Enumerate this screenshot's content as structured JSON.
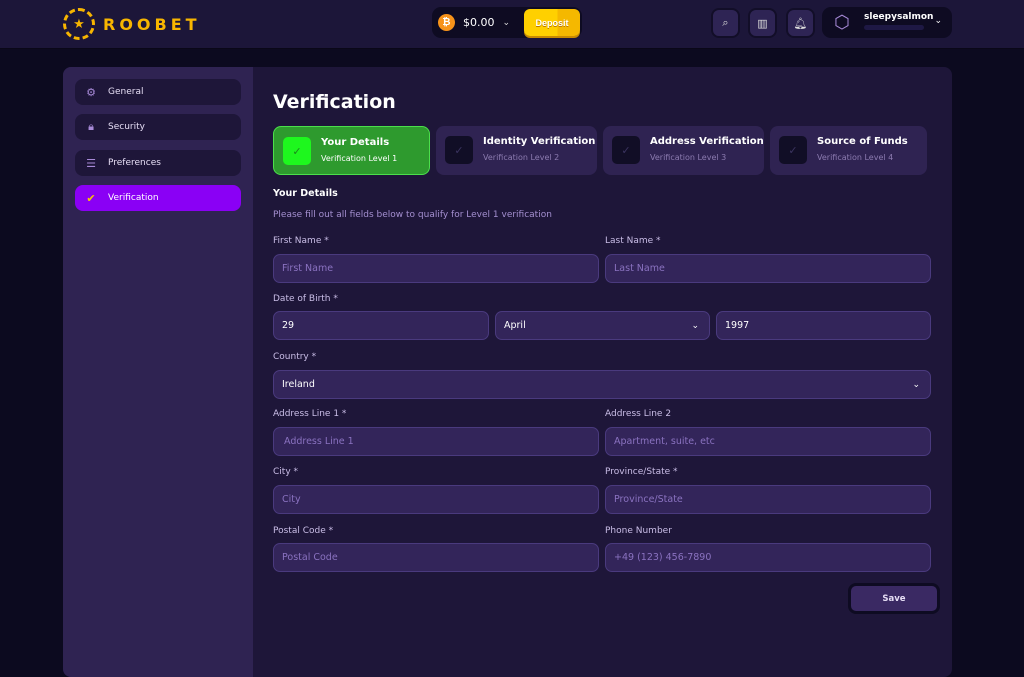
{
  "header": {
    "brand": "ROOBET",
    "balance": "$0.00",
    "deposit_label": "Deposit",
    "username": "sleepysalmon"
  },
  "sidebar": {
    "items": [
      {
        "label": "General",
        "icon": "gear-icon"
      },
      {
        "label": "Security",
        "icon": "lock-icon"
      },
      {
        "label": "Preferences",
        "icon": "sliders-icon"
      },
      {
        "label": "Verification",
        "icon": "check-circle-icon",
        "active": true
      }
    ]
  },
  "main": {
    "title": "Verification",
    "steps": [
      {
        "title": "Your Details",
        "subtitle": "Verification Level 1",
        "done": true
      },
      {
        "title": "Identity Verification",
        "subtitle": "Verification Level 2"
      },
      {
        "title": "Address Verification",
        "subtitle": "Verification Level 3"
      },
      {
        "title": "Source of Funds",
        "subtitle": "Verification Level 4"
      }
    ],
    "section_title": "Your Details",
    "section_desc": "Please fill out all fields below to qualify for Level 1 verification",
    "fields": {
      "first_name": {
        "label": "First Name *",
        "placeholder": "First Name"
      },
      "last_name": {
        "label": "Last Name *",
        "placeholder": "Last Name"
      },
      "dob": {
        "label": "Date of Birth *",
        "day": "29",
        "month": "April",
        "year": "1997"
      },
      "country": {
        "label": "Country *",
        "value": "Ireland"
      },
      "address1": {
        "label": "Address Line 1 *",
        "placeholder": "Address Line 1"
      },
      "address2": {
        "label": "Address Line 2",
        "placeholder": "Apartment, suite, etc"
      },
      "city": {
        "label": "City *",
        "placeholder": "City"
      },
      "province": {
        "label": "Province/State *",
        "placeholder": "Province/State"
      },
      "postal": {
        "label": "Postal Code *",
        "placeholder": "Postal Code"
      },
      "phone": {
        "label": "Phone Number",
        "placeholder": "+49 (123) 456-7890"
      }
    },
    "save_label": "Save"
  },
  "colors": {
    "accent": "#8a00f5",
    "brand": "#f7b500",
    "success": "#2e9a2e"
  }
}
